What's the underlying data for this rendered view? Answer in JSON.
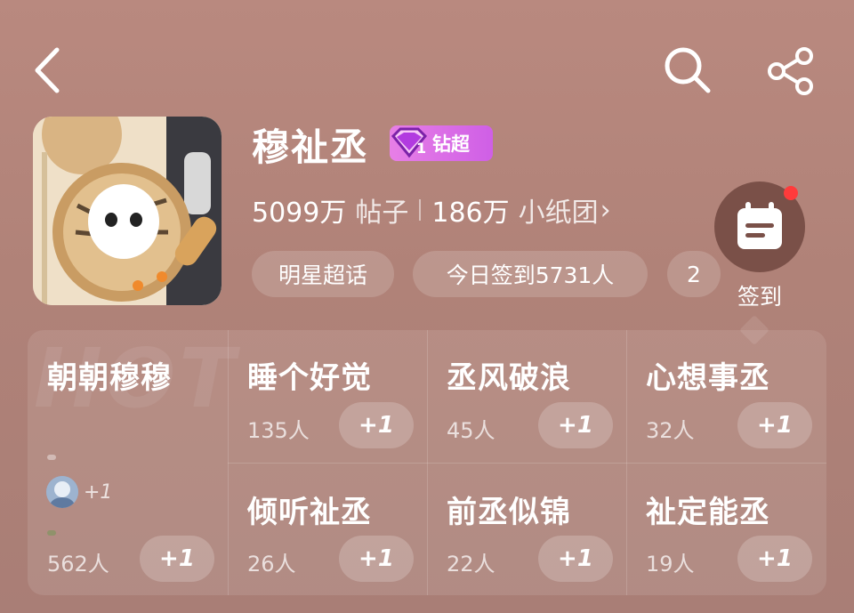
{
  "topbar": {
    "back_icon": "chevron-left-icon",
    "search_icon": "search-icon",
    "share_icon": "share-icon"
  },
  "header": {
    "title": "穆祉丞",
    "badge": {
      "level": "1",
      "label": "钻超"
    },
    "stats": {
      "posts_value": "5099万",
      "posts_label": "帖子",
      "groups_value": "186万",
      "groups_label": "小纸团",
      "chevron": "›"
    },
    "chips": [
      {
        "label": "明星超话"
      },
      {
        "label": "今日签到5731人"
      },
      {
        "label": "2"
      }
    ]
  },
  "checkin": {
    "label": "签到",
    "icon": "calendar-icon",
    "has_notification": true
  },
  "panel": {
    "watermark": "HOT",
    "featured": {
      "title": "朝朝穆穆",
      "avatar_plus": "+1",
      "count": "562人",
      "plus_label": "+1"
    },
    "topics": [
      {
        "title": "睡个好觉",
        "count": "135人",
        "plus_label": "+1"
      },
      {
        "title": "丞风破浪",
        "count": "45人",
        "plus_label": "+1"
      },
      {
        "title": "心想事丞",
        "count": "32人",
        "plus_label": "+1"
      },
      {
        "title": "倾听祉丞",
        "count": "26人",
        "plus_label": "+1"
      },
      {
        "title": "前丞似锦",
        "count": "22人",
        "plus_label": "+1"
      },
      {
        "title": "祉定能丞",
        "count": "19人",
        "plus_label": "+1"
      }
    ]
  },
  "colors": {
    "background": "#b08278",
    "badge": "#d56ae6",
    "notification_dot": "#ff3b3b",
    "checkin_button": "#7a5048"
  }
}
